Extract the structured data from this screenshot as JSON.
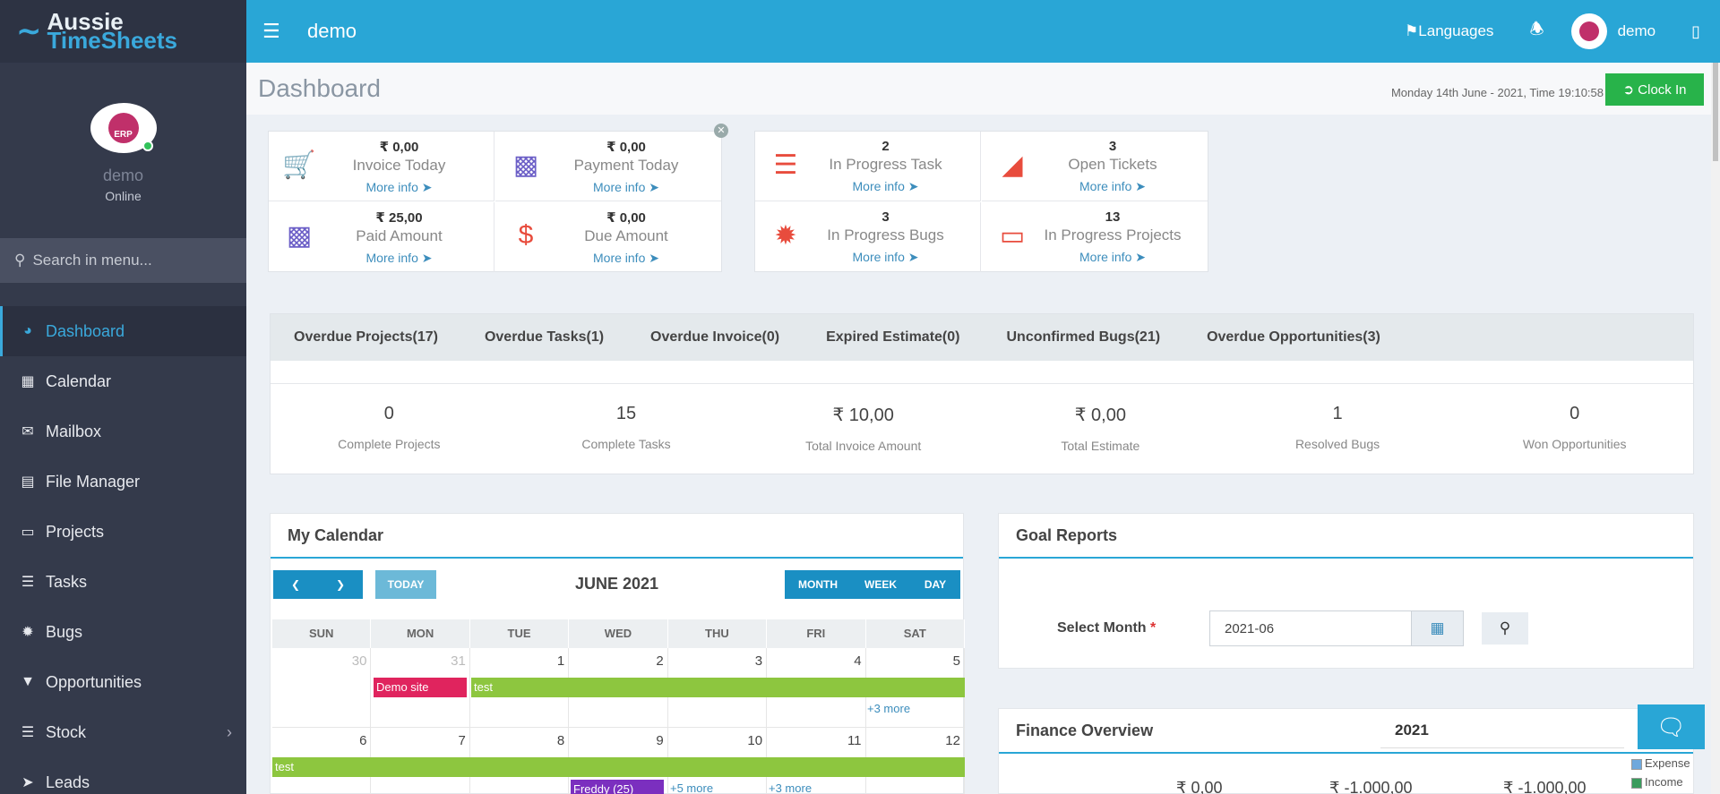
{
  "brand": {
    "line1": "Aussie",
    "line2": "TimeSheets"
  },
  "user": {
    "name": "demo",
    "status": "Online",
    "avatar_text": "ERP"
  },
  "search": {
    "placeholder": "Search in menu..."
  },
  "menu": [
    {
      "label": "Dashboard",
      "icon": "dashboard-icon"
    },
    {
      "label": "Calendar",
      "icon": "calendar-icon"
    },
    {
      "label": "Mailbox",
      "icon": "envelope-icon"
    },
    {
      "label": "File Manager",
      "icon": "file-icon"
    },
    {
      "label": "Projects",
      "icon": "folder-icon"
    },
    {
      "label": "Tasks",
      "icon": "tasks-icon"
    },
    {
      "label": "Bugs",
      "icon": "bug-icon"
    },
    {
      "label": "Opportunities",
      "icon": "filter-icon"
    },
    {
      "label": "Stock",
      "icon": "layers-icon"
    },
    {
      "label": "Leads",
      "icon": "rocket-icon"
    }
  ],
  "topbar": {
    "title": "demo",
    "languages": "Languages",
    "user": "demo"
  },
  "header": {
    "title": "Dashboard",
    "datetime": "Monday 14th June - 2021,  Time  19:10:58",
    "clock_in": "Clock In"
  },
  "stats_left": [
    {
      "value": "₹ 0,00",
      "label": "Invoice Today",
      "more": "More info",
      "icon": "cart-icon",
      "color": "#555555"
    },
    {
      "value": "₹ 0,00",
      "label": "Payment Today",
      "more": "More info",
      "icon": "money-icon",
      "color": "#6c5fc7"
    },
    {
      "value": "₹ 25,00",
      "label": "Paid Amount",
      "more": "More info",
      "icon": "money-icon",
      "color": "#6c5fc7"
    },
    {
      "value": "₹ 0,00",
      "label": "Due Amount",
      "more": "More info",
      "icon": "dollar-icon",
      "color": "#e84c3d"
    }
  ],
  "stats_right": [
    {
      "value": "2",
      "label": "In Progress Task",
      "more": "More info",
      "icon": "tasks-icon",
      "color": "#e84c3d"
    },
    {
      "value": "3",
      "label": "Open Tickets",
      "more": "More info",
      "icon": "ticket-icon",
      "color": "#e84c3d"
    },
    {
      "value": "3",
      "label": "In Progress Bugs",
      "more": "More info",
      "icon": "bug-icon",
      "color": "#e84c3d"
    },
    {
      "value": "13",
      "label": "In Progress Projects",
      "more": "More info",
      "icon": "folder-open-icon",
      "color": "#e84c3d"
    }
  ],
  "overdue_tabs": [
    "Overdue Projects(17)",
    "Overdue Tasks(1)",
    "Overdue Invoice(0)",
    "Expired Estimate(0)",
    "Unconfirmed Bugs(21)",
    "Overdue Opportunities(3)"
  ],
  "metrics": [
    {
      "value": "0",
      "label": "Complete Projects"
    },
    {
      "value": "15",
      "label": "Complete Tasks"
    },
    {
      "value": "₹ 10,00",
      "label": "Total Invoice Amount"
    },
    {
      "value": "₹ 0,00",
      "label": "Total Estimate"
    },
    {
      "value": "1",
      "label": "Resolved Bugs"
    },
    {
      "value": "0",
      "label": "Won Opportunities"
    }
  ],
  "calendar": {
    "title": "My Calendar",
    "month_label": "JUNE 2021",
    "today": "TODAY",
    "views": [
      "MONTH",
      "WEEK",
      "DAY"
    ],
    "weekdays": [
      "SUN",
      "MON",
      "TUE",
      "WED",
      "THU",
      "FRI",
      "SAT"
    ],
    "weeks": [
      [
        "30",
        "31",
        "1",
        "2",
        "3",
        "4",
        "5"
      ],
      [
        "6",
        "7",
        "8",
        "9",
        "10",
        "11",
        "12"
      ]
    ],
    "events": [
      {
        "label": "Demo site",
        "color": "#e0245e"
      },
      {
        "label": "test",
        "color": "#8dc63f"
      },
      {
        "label": "test",
        "color": "#8dc63f"
      },
      {
        "label": "Freddy (25)",
        "color": "#7b2fbf"
      }
    ],
    "more_labels": [
      "+3 more",
      "+5 more",
      "+3 more"
    ]
  },
  "goal": {
    "title": "Goal Reports",
    "label": "Select Month",
    "required": "*",
    "value": "2021-06"
  },
  "finance": {
    "title": "Finance Overview",
    "year": "2021",
    "legend": [
      "Expense",
      "Income"
    ],
    "legend_colors": [
      "#6fa8dc",
      "#3a9b5c"
    ],
    "values": [
      "₹ 0,00",
      "₹ -1.000,00",
      "₹ -1.000,00"
    ]
  }
}
